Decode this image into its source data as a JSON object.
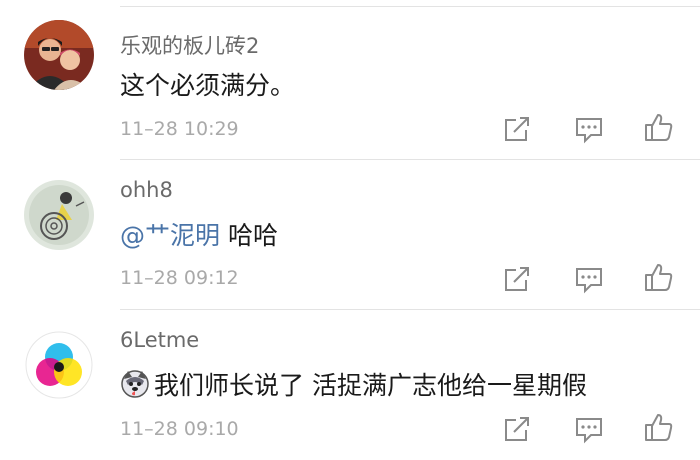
{
  "comments": [
    {
      "username": "乐观的板儿砖2",
      "text": "这个必须满分。",
      "time": "11–28 10:29",
      "avatar_icon": "user-photo-couple"
    },
    {
      "username": "ohh8",
      "mention": "@艹泥明",
      "text": "哈哈",
      "time": "11–28 09:12",
      "avatar_icon": "user-illustration-girl-dress"
    },
    {
      "username": "6Letme",
      "emoji_icon": "husky-dog-emoji",
      "text": "我们师长说了 活捉满广志他给一星期假",
      "time": "11–28 09:10",
      "avatar_icon": "user-cmyk-circles"
    }
  ],
  "actions": {
    "share_icon": "share-icon",
    "reply_icon": "comment-icon",
    "like_icon": "thumbs-up-icon"
  },
  "colors": {
    "username": "#6a6a6a",
    "mention": "#4a74a8",
    "time": "#a9a9a9",
    "icon": "#8a8a8a"
  }
}
